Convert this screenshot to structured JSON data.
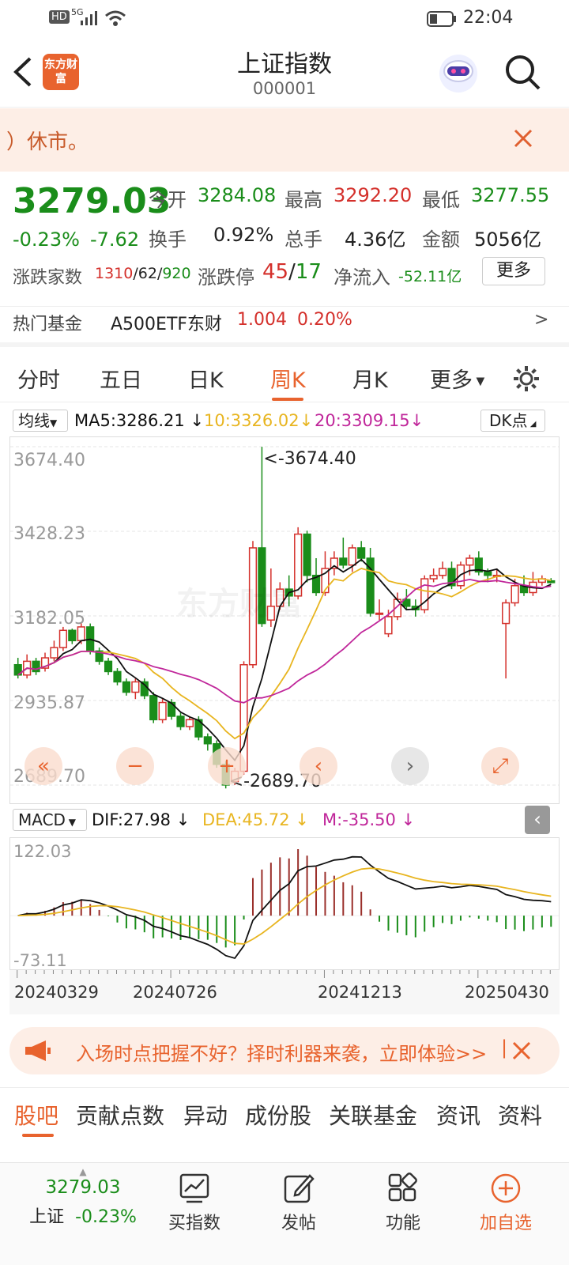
{
  "status": {
    "network": "5G",
    "time": "22:04"
  },
  "header": {
    "title": "上证指数",
    "code": "000001",
    "logo": "东方财富"
  },
  "notice": {
    "text": "）休市。"
  },
  "quote": {
    "price": "3279.03",
    "change_pct": "-0.23%",
    "change": "-7.62",
    "open_label": "今开",
    "open": "3284.08",
    "high_label": "最高",
    "high": "3292.20",
    "low_label": "最低",
    "low": "3277.55",
    "turnover_label": "换手",
    "turnover": "0.92%",
    "volume_label": "总手",
    "volume": "4.36亿",
    "amount_label": "金额",
    "amount": "5056亿",
    "breadth_label": "涨跌家数",
    "up_count": "1310",
    "sep1": "/62/",
    "down_count": "920",
    "limit_label": "涨跌停",
    "limit_up": "45",
    "limit_sep": "/",
    "limit_down": "17",
    "inflow_label": "净流入",
    "inflow": "-52.11亿",
    "more_button": "更多"
  },
  "fund": {
    "label": "热门基金",
    "name": "A500ETF东财",
    "value": "1.004",
    "pct": "0.20%",
    "arrow": ">"
  },
  "tabs": [
    "分时",
    "五日",
    "日K",
    "周K",
    "月K",
    "更多"
  ],
  "chart": {
    "ma_select": "均线",
    "ma5": "MA5:3286.21",
    "ma10": "10:3326.02",
    "ma20": "20:3309.15",
    "dk_button": "DK点",
    "y_labels": [
      "3674.40",
      "3428.23",
      "3182.05",
      "2935.87",
      "2689.70"
    ],
    "max_marker": "<-3674.40",
    "min_marker": "<-2689.70",
    "watermark": "东方财富"
  },
  "macd": {
    "select": "MACD",
    "dif": "DIF:27.98",
    "dea": "DEA:45.72",
    "m": "M:-35.50",
    "y_top": "122.03",
    "y_bottom": "-73.11"
  },
  "dates": [
    "20240329",
    "20240726",
    "20241213",
    "20250430"
  ],
  "ad": {
    "text": "入场时点把握不好？择时利器来袭，立即体验>>"
  },
  "bottom_tabs": [
    "股吧",
    "贡献点数",
    "异动",
    "成份股",
    "关联基金",
    "资讯",
    "资料"
  ],
  "tabbar": {
    "index_price": "3279.03",
    "index_name": "上证",
    "index_pct": "-0.23%",
    "items": [
      "买指数",
      "发帖",
      "功能",
      "加自选"
    ]
  },
  "colors": {
    "up": "#d4302b",
    "down": "#1a8d1a",
    "accent": "#e8632e",
    "ma5": "#111111",
    "ma10": "#e8b520",
    "ma20": "#c0269a"
  },
  "chart_data": {
    "type": "candlestick",
    "title": "",
    "y_range": [
      2689.7,
      3674.4
    ],
    "candles": [
      [
        3040,
        3010,
        3060,
        3000
      ],
      [
        3010,
        3050,
        3070,
        3000
      ],
      [
        3050,
        3020,
        3060,
        3010
      ],
      [
        3030,
        3060,
        3075,
        3020
      ],
      [
        3060,
        3090,
        3110,
        3050
      ],
      [
        3090,
        3140,
        3150,
        3080
      ],
      [
        3140,
        3110,
        3145,
        3100
      ],
      [
        3110,
        3150,
        3160,
        3100
      ],
      [
        3150,
        3080,
        3160,
        3070
      ],
      [
        3080,
        3050,
        3090,
        3040
      ],
      [
        3050,
        3020,
        3060,
        3010
      ],
      [
        3020,
        2990,
        3030,
        2980
      ],
      [
        2990,
        2960,
        3000,
        2950
      ],
      [
        2960,
        2990,
        3000,
        2940
      ],
      [
        2990,
        2950,
        3000,
        2940
      ],
      [
        2950,
        2880,
        2960,
        2870
      ],
      [
        2880,
        2930,
        2940,
        2870
      ],
      [
        2930,
        2890,
        2940,
        2880
      ],
      [
        2890,
        2860,
        2900,
        2850
      ],
      [
        2860,
        2880,
        2890,
        2850
      ],
      [
        2880,
        2830,
        2890,
        2820
      ],
      [
        2830,
        2810,
        2840,
        2790
      ],
      [
        2810,
        2750,
        2820,
        2740
      ],
      [
        2750,
        2690,
        2760,
        2680
      ],
      [
        2700,
        2730,
        2740,
        2690
      ],
      [
        2730,
        3040,
        3050,
        2720
      ],
      [
        3040,
        3380,
        3400,
        3030
      ],
      [
        3380,
        3160,
        3674,
        3150
      ],
      [
        3170,
        3210,
        3320,
        3150
      ],
      [
        3210,
        3260,
        3280,
        3200
      ],
      [
        3260,
        3240,
        3300,
        3210
      ],
      [
        3240,
        3420,
        3440,
        3230
      ],
      [
        3420,
        3300,
        3430,
        3280
      ],
      [
        3300,
        3250,
        3350,
        3240
      ],
      [
        3250,
        3320,
        3370,
        3240
      ],
      [
        3320,
        3350,
        3370,
        3300
      ],
      [
        3350,
        3330,
        3410,
        3320
      ],
      [
        3330,
        3380,
        3390,
        3310
      ],
      [
        3380,
        3350,
        3400,
        3340
      ],
      [
        3350,
        3190,
        3380,
        3180
      ],
      [
        3190,
        3190,
        3230,
        3170
      ],
      [
        3130,
        3180,
        3200,
        3120
      ],
      [
        3180,
        3230,
        3250,
        3170
      ],
      [
        3230,
        3210,
        3260,
        3200
      ],
      [
        3210,
        3200,
        3230,
        3180
      ],
      [
        3200,
        3290,
        3300,
        3190
      ],
      [
        3290,
        3300,
        3320,
        3280
      ],
      [
        3300,
        3320,
        3340,
        3290
      ],
      [
        3320,
        3270,
        3340,
        3260
      ],
      [
        3270,
        3330,
        3340,
        3260
      ],
      [
        3330,
        3350,
        3360,
        3300
      ],
      [
        3350,
        3310,
        3370,
        3300
      ],
      [
        3310,
        3300,
        3320,
        3280
      ],
      [
        3300,
        3300,
        3320,
        3280
      ],
      [
        3160,
        3220,
        3230,
        3000
      ],
      [
        3220,
        3270,
        3290,
        3210
      ],
      [
        3270,
        3250,
        3300,
        3240
      ],
      [
        3250,
        3280,
        3310,
        3240
      ],
      [
        3280,
        3290,
        3300,
        3270
      ],
      [
        3284,
        3279,
        3292,
        3277
      ]
    ]
  }
}
